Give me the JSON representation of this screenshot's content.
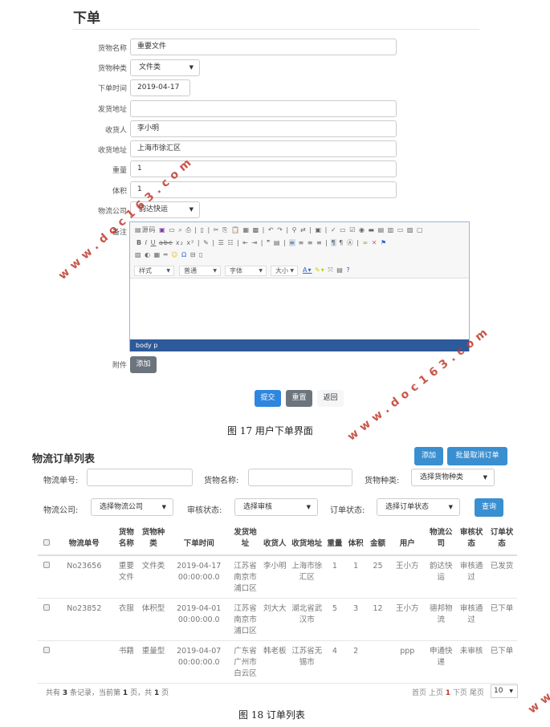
{
  "order_form": {
    "title": "下单",
    "fields": [
      {
        "label": "货物名称",
        "value": "重要文件",
        "type": "text"
      },
      {
        "label": "货物种类",
        "value": "文件类",
        "type": "select"
      },
      {
        "label": "下单时间",
        "value": "2019-04-17",
        "type": "date"
      },
      {
        "label": "发货地址",
        "value": "",
        "type": "text"
      },
      {
        "label": "收货人",
        "value": "李小明",
        "type": "text"
      },
      {
        "label": "收货地址",
        "value": "上海市徐汇区",
        "type": "text"
      },
      {
        "label": "重量",
        "value": "1",
        "type": "text"
      },
      {
        "label": "体积",
        "value": "1",
        "type": "text"
      },
      {
        "label": "物流公司",
        "value": "韵达快运",
        "type": "select"
      }
    ],
    "remark_label": "备注",
    "editor": {
      "source_label": "源码",
      "dropdowns": [
        "样式",
        "普通",
        "字体",
        "大小"
      ],
      "footer_path": "body  p"
    },
    "attachment_label": "附件",
    "attachment_button": "添加",
    "submit_button": "提交",
    "reset_button": "重置",
    "back_button": "返回"
  },
  "caption_17": "图 17 用户下单界面",
  "order_list": {
    "title": "物流订单列表",
    "add_button": "添加",
    "batch_cancel_button": "批量取消订单",
    "filters": {
      "tracking_no_label": "物流单号:",
      "tracking_no_value": "",
      "goods_name_label": "货物名称:",
      "goods_name_value": "",
      "goods_type_label": "货物种类:",
      "goods_type_value": "选择货物种类",
      "company_label": "物流公司:",
      "company_value": "选择物流公司",
      "review_label": "审核状态:",
      "review_value": "选择审核",
      "order_status_label": "订单状态:",
      "order_status_value": "选择订单状态",
      "search_button": "查询"
    },
    "columns": [
      "物流单号",
      "货物名称",
      "货物种类",
      "下单时间",
      "发货地址",
      "收货人",
      "收货地址",
      "重量",
      "体积",
      "金额",
      "用户",
      "物流公司",
      "审核状态",
      "订单状态"
    ],
    "rows": [
      {
        "no": "No23656",
        "name": "重要文件",
        "type": "文件类",
        "time": "2019-04-17 00:00:00.0",
        "from": "江苏省南京市浦口区",
        "receiver": "李小明",
        "to": "上海市徐汇区",
        "weight": "1",
        "volume": "1",
        "amount": "25",
        "user": "王小方",
        "company": "韵达快运",
        "review": "审核通过",
        "status": "已发货"
      },
      {
        "no": "No23852",
        "name": "衣服",
        "type": "体积型",
        "time": "2019-04-01 00:00:00.0",
        "from": "江苏省南京市浦口区",
        "receiver": "刘大大",
        "to": "湖北省武汉市",
        "weight": "5",
        "volume": "3",
        "amount": "12",
        "user": "王小方",
        "company": "德邦物流",
        "review": "审核通过",
        "status": "已下单"
      },
      {
        "no": "",
        "name": "书籍",
        "type": "重量型",
        "time": "2019-04-07 00:00:00.0",
        "from": "广东省广州市白云区",
        "receiver": "韩老板",
        "to": "江苏省无锡市",
        "weight": "4",
        "volume": "2",
        "amount": "",
        "user": "ppp",
        "company": "申通快递",
        "review": "未审核",
        "status": "已下单"
      }
    ],
    "pagination": {
      "prefix": "共有",
      "total": "3",
      "mid1": "条记录，当前第",
      "current": "1",
      "mid2": "页，共",
      "pages": "1",
      "suffix": "页",
      "first": "首页",
      "prev": "上页",
      "page": "1",
      "next": "下页",
      "last": "尾页",
      "page_size": "10"
    }
  },
  "caption_18": "图 18 订单列表",
  "watermark": "www.doc163.com",
  "colors": {
    "primary": "#2e86de",
    "secondary": "#6c757d",
    "editor_footer": "#2d5a9a",
    "watermark": "#c0392b"
  }
}
